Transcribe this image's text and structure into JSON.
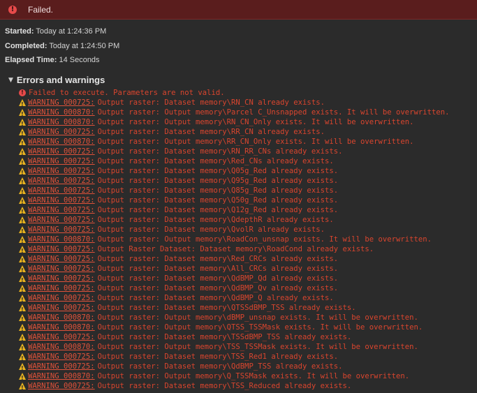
{
  "banner": {
    "text": "Failed."
  },
  "info": [
    {
      "label": "Started:",
      "value": "Today at 1:24:36 PM"
    },
    {
      "label": "Completed:",
      "value": "Today at 1:24:50 PM"
    },
    {
      "label": "Elapsed Time:",
      "value": "14 Seconds"
    }
  ],
  "section": {
    "title": "Errors and warnings"
  },
  "error": {
    "text": "Failed to execute. Parameters are not valid."
  },
  "warnings": [
    {
      "code": "WARNING 000725:",
      "message": "Output raster: Dataset memory\\RN_CN already exists."
    },
    {
      "code": "WARNING 000870:",
      "message": "Output raster: Output memory\\Parcel C_Unsnapped exists. It will be overwritten."
    },
    {
      "code": "WARNING 000870:",
      "message": "Output raster: Output memory\\RN_CN_Only exists. It will be overwritten."
    },
    {
      "code": "WARNING 000725:",
      "message": "Output raster: Dataset memory\\RR_CN already exists."
    },
    {
      "code": "WARNING 000870:",
      "message": "Output raster: Output memory\\RR_CN_Only exists. It will be overwritten."
    },
    {
      "code": "WARNING 000725:",
      "message": "Output raster: Dataset memory\\RN_RR_CNs already exists."
    },
    {
      "code": "WARNING 000725:",
      "message": "Output raster: Dataset memory\\Red_CNs already exists."
    },
    {
      "code": "WARNING 000725:",
      "message": "Output raster: Dataset memory\\Q05g_Red already exists."
    },
    {
      "code": "WARNING 000725:",
      "message": "Output raster: Dataset memory\\Q95g_Red already exists."
    },
    {
      "code": "WARNING 000725:",
      "message": "Output raster: Dataset memory\\Q85g_Red already exists."
    },
    {
      "code": "WARNING 000725:",
      "message": "Output raster: Dataset memory\\Q50g_Red already exists."
    },
    {
      "code": "WARNING 000725:",
      "message": "Output raster: Dataset memory\\Q12g_Red already exists."
    },
    {
      "code": "WARNING 000725:",
      "message": "Output raster: Dataset memory\\QdepthR already exists."
    },
    {
      "code": "WARNING 000725:",
      "message": "Output raster: Dataset memory\\QvolR already exists."
    },
    {
      "code": "WARNING 000870:",
      "message": "Output raster: Output memory\\RoadCon_unsnap exists. It will be overwritten."
    },
    {
      "code": "WARNING 000725:",
      "message": "Output Raster Dataset: Dataset memory\\RoadCond already exists."
    },
    {
      "code": "WARNING 000725:",
      "message": "Output raster: Dataset memory\\Red_CRCs already exists."
    },
    {
      "code": "WARNING 000725:",
      "message": "Output raster: Dataset memory\\All_CRCs already exists."
    },
    {
      "code": "WARNING 000725:",
      "message": "Output raster: Dataset memory\\QdBMP_Qd already exists."
    },
    {
      "code": "WARNING 000725:",
      "message": "Output raster: Dataset memory\\QdBMP_Qv already exists."
    },
    {
      "code": "WARNING 000725:",
      "message": "Output raster: Dataset memory\\QdBMP_Q already exists."
    },
    {
      "code": "WARNING 000725:",
      "message": "Output raster: Dataset memory\\QTSSdBMP_TSS already exists."
    },
    {
      "code": "WARNING 000870:",
      "message": "Output raster: Output memory\\dBMP_unsnap exists. It will be overwritten."
    },
    {
      "code": "WARNING 000870:",
      "message": "Output raster: Output memory\\QTSS_TSSMask exists. It will be overwritten."
    },
    {
      "code": "WARNING 000725:",
      "message": "Output raster: Dataset memory\\TSSdBMP_TSS already exists."
    },
    {
      "code": "WARNING 000870:",
      "message": "Output raster: Output memory\\TSS_TSSMask exists. It will be overwritten."
    },
    {
      "code": "WARNING 000725:",
      "message": "Output raster: Dataset memory\\TSS_Red1 already exists."
    },
    {
      "code": "WARNING 000725:",
      "message": "Output raster: Dataset memory\\QdBMP_TSS already exists."
    },
    {
      "code": "WARNING 000870:",
      "message": "Output raster: Output memory\\Q_TSSMask exists. It will be overwritten."
    },
    {
      "code": "WARNING 000725:",
      "message": "Output raster: Dataset memory\\TSS_Reduced already exists."
    }
  ],
  "colors": {
    "error": "#d9452e",
    "warning_icon": "#e8b21f",
    "banner_bg": "#5a1d1d"
  }
}
